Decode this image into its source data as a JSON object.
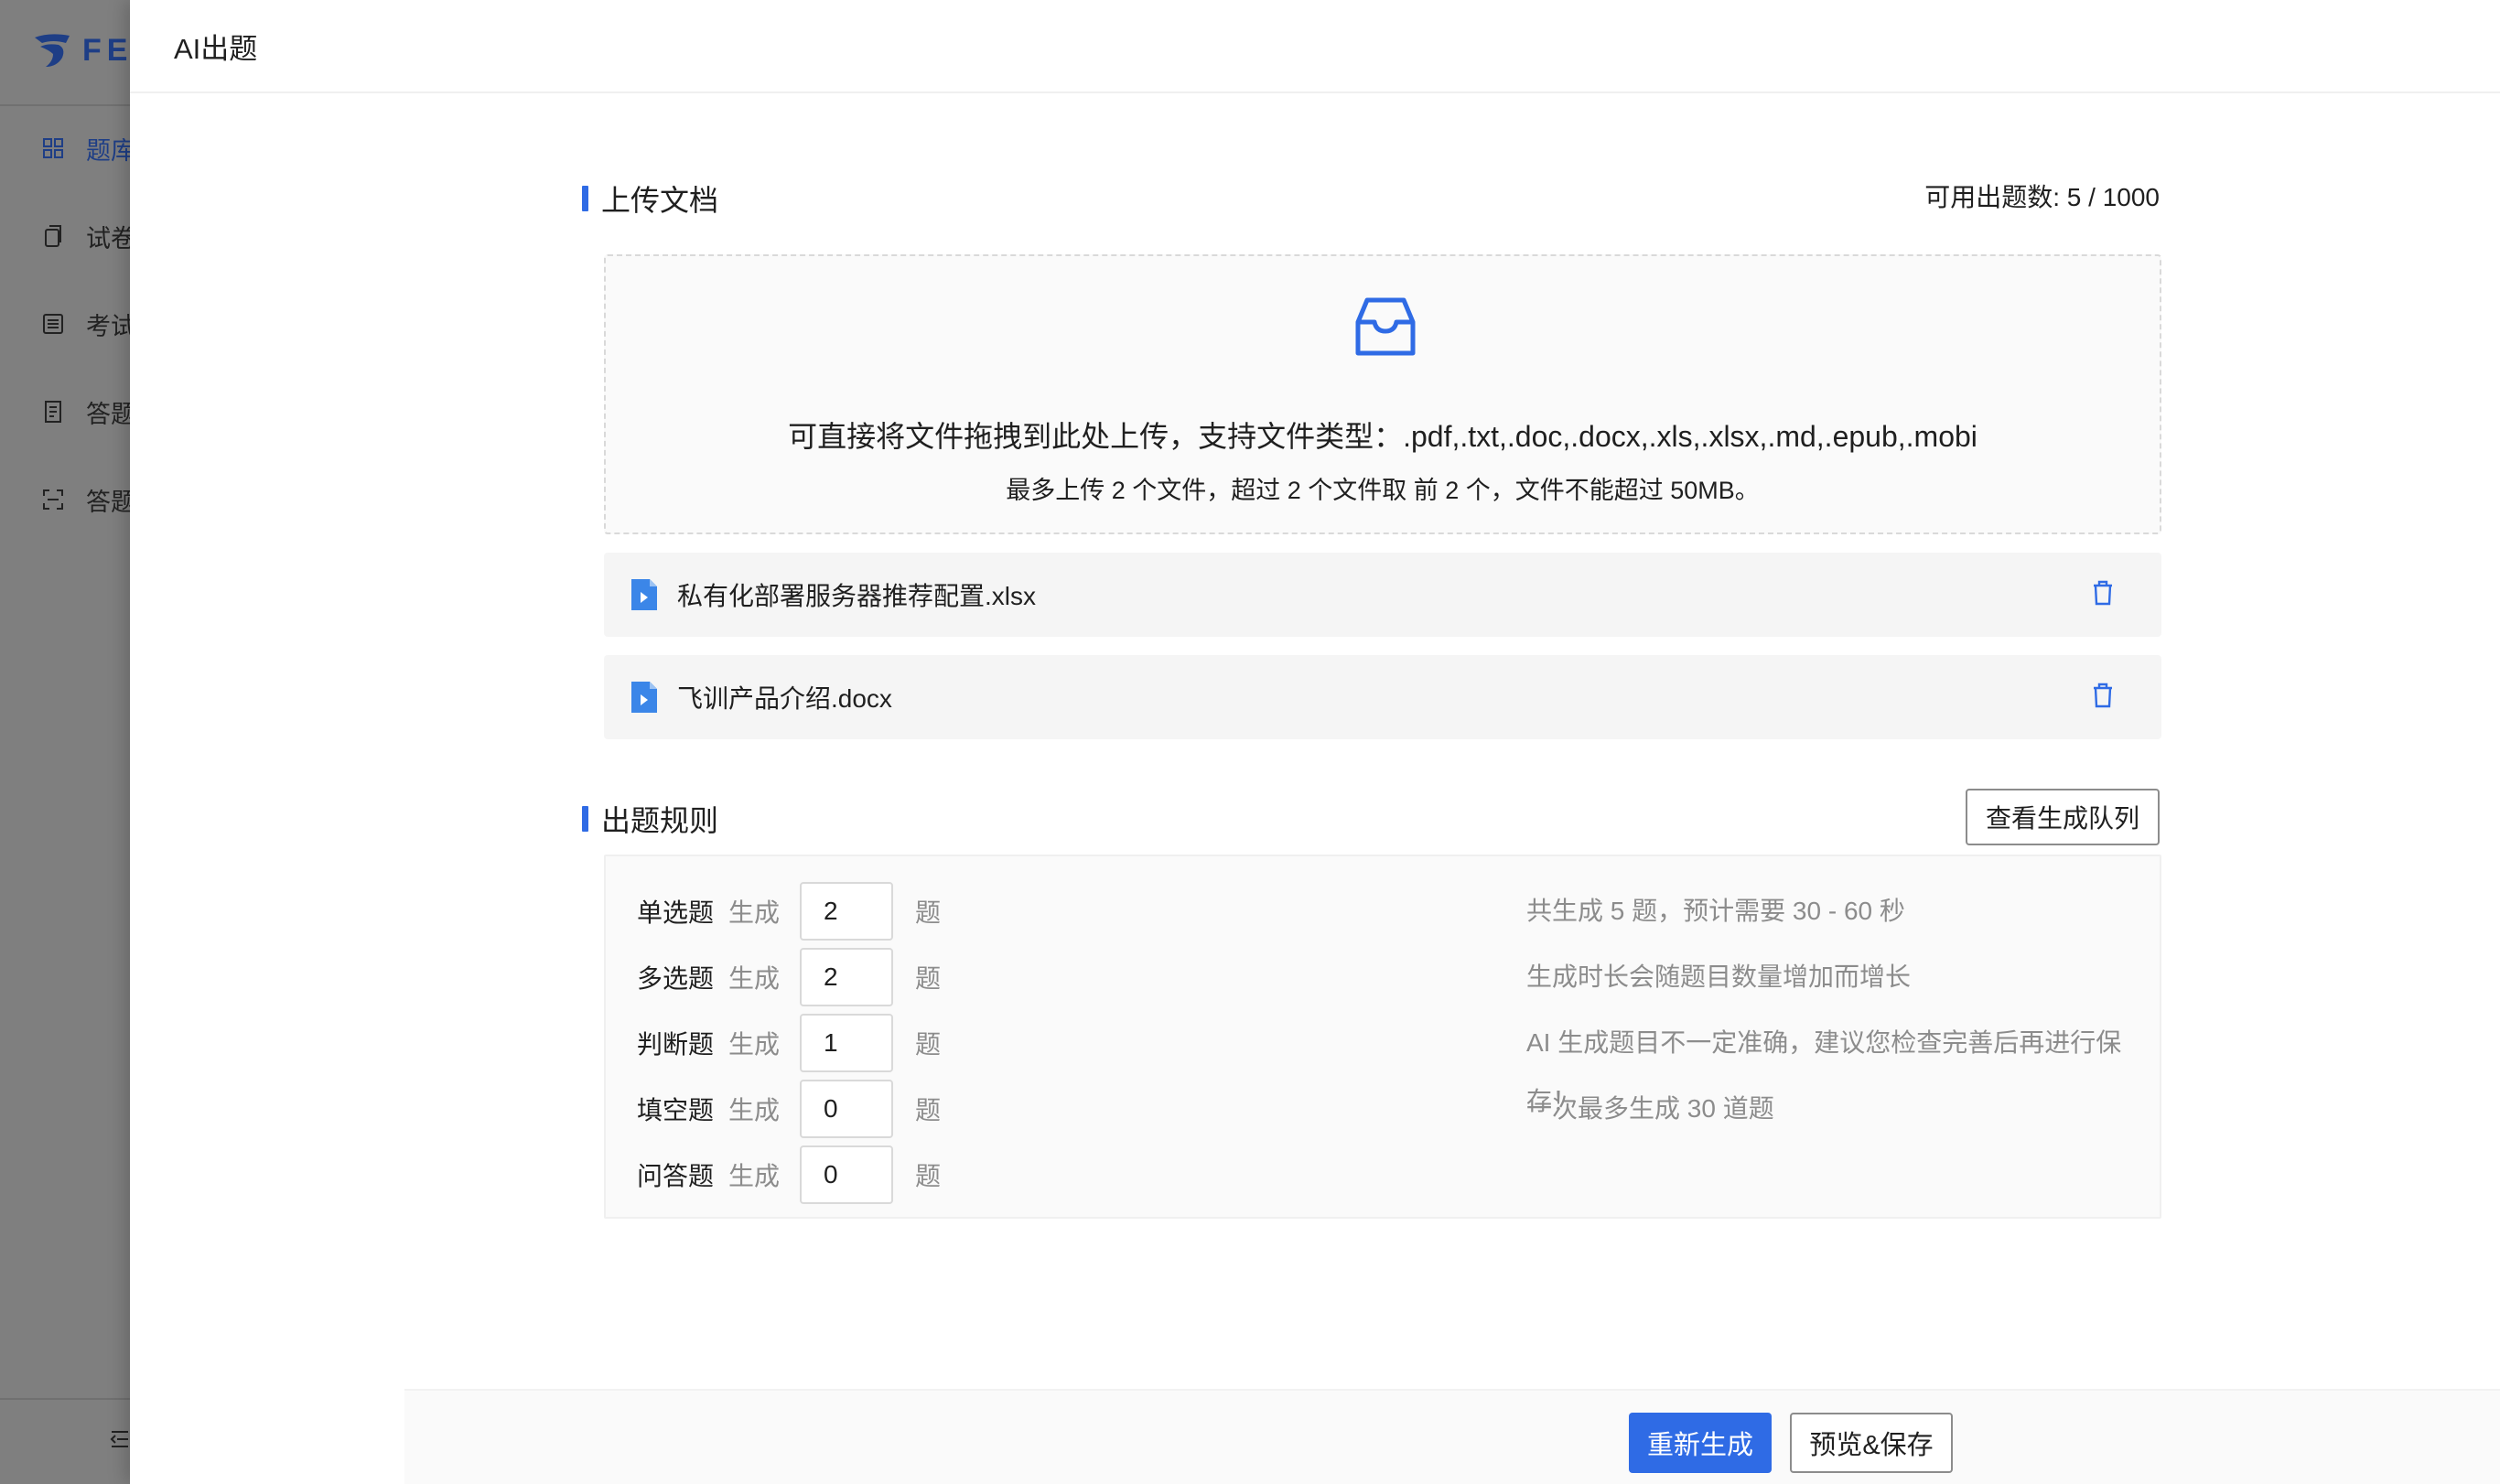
{
  "background_sidebar": {
    "logo_text": "FE",
    "nav_items": [
      {
        "icon": "grid-icon",
        "label": "题库",
        "active": true
      },
      {
        "icon": "copy-icon",
        "label": "试卷",
        "active": false
      },
      {
        "icon": "list-icon",
        "label": "考试",
        "active": false
      },
      {
        "icon": "document-icon",
        "label": "答题",
        "active": false
      },
      {
        "icon": "scan-icon",
        "label": "答题",
        "active": false
      }
    ],
    "collapse_icon": "menu-fold-icon"
  },
  "drawer": {
    "title": "AI出题"
  },
  "upload": {
    "section_title": "上传文档",
    "quota_label": "可用出题数: 5 / 1000",
    "icon": "inbox-icon",
    "hint": "可直接将文件拖拽到此处上传，支持文件类型：.pdf,.txt,.doc,.docx,.xls,.xlsx,.md,.epub,.mobi",
    "sub_hint": "最多上传 2 个文件，超过 2 个文件取 前 2 个，文件不能超过 50MB。",
    "files": [
      {
        "name": "私有化部署服务器推荐配置.xlsx",
        "icon": "file-icon",
        "delete_icon": "trash-icon"
      },
      {
        "name": "飞训产品介绍.docx",
        "icon": "file-icon",
        "delete_icon": "trash-icon"
      }
    ]
  },
  "rules": {
    "section_title": "出题规则",
    "queue_button": "查看生成队列",
    "gen_label": "生成",
    "unit_label": "题",
    "rows": [
      {
        "type": "单选题",
        "count": "2"
      },
      {
        "type": "多选题",
        "count": "2"
      },
      {
        "type": "判断题",
        "count": "1"
      },
      {
        "type": "填空题",
        "count": "0"
      },
      {
        "type": "问答题",
        "count": "0"
      }
    ],
    "notes": [
      "共生成 5 题，预计需要 30 - 60 秒",
      "生成时长会随题目数量增加而增长",
      "AI 生成题目不一定准确，建议您检查完善后再进行保存！",
      "一次最多生成 30 道题"
    ]
  },
  "footer": {
    "regenerate_button": "重新生成",
    "preview_save_button": "预览&保存"
  },
  "colors": {
    "accent": "#2f6be5",
    "overlay_sidebar": "#7f7f7f"
  }
}
